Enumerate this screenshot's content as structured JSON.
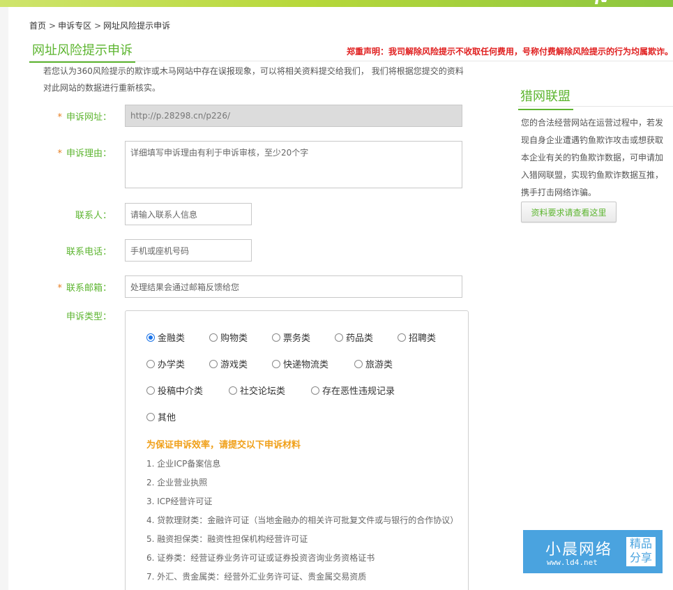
{
  "breadcrumb": {
    "home": "首页",
    "sep1": ">",
    "zone": "申诉专区",
    "sep2": ">",
    "current": "网址风险提示申诉"
  },
  "header": {
    "title": "网址风险提示申诉",
    "warning": "郑重声明：我司解除风险提示不收取任何费用，号称付费解除风险提示的行为均属欺诈。"
  },
  "intro": {
    "line1": "若您认为360风险提示的欺诈或木马网站中存在误报现象，可以将相关资料提交给我们， 我们将根据您提交的资料",
    "line2": "对此网站的数据进行重新核实。"
  },
  "form": {
    "required_mark": "*",
    "url_label": "申诉网址：",
    "url_value": "http://p.28298.cn/p226/",
    "reason_label": "申诉理由：",
    "reason_placeholder": "详细填写申诉理由有利于申诉审核，至少20个字",
    "contact_label": "联系人：",
    "contact_placeholder": "请输入联系人信息",
    "phone_label": "联系电话：",
    "phone_placeholder": "手机或座机号码",
    "email_label": "联系邮箱：",
    "email_placeholder": "处理结果会通过邮箱反馈给您",
    "type_label": "申诉类型："
  },
  "types": [
    {
      "label": "金融类",
      "checked": true
    },
    {
      "label": "购物类",
      "checked": false
    },
    {
      "label": "票务类",
      "checked": false
    },
    {
      "label": "药品类",
      "checked": false
    },
    {
      "label": "招聘类",
      "checked": false
    },
    {
      "label": "办学类",
      "checked": false
    },
    {
      "label": "游戏类",
      "checked": false
    },
    {
      "label": "快递物流类",
      "checked": false
    },
    {
      "label": "旅游类",
      "checked": false
    },
    {
      "label": "投稿中介类",
      "checked": false
    },
    {
      "label": "社交论坛类",
      "checked": false
    },
    {
      "label": "存在恶性违规记录",
      "checked": false
    },
    {
      "label": "其他",
      "checked": false
    }
  ],
  "materials": {
    "title": "为保证申诉效率，请提交以下申诉材料",
    "items": [
      "1. 企业ICP备案信息",
      "2. 企业营业执照",
      "3. ICP经营许可证",
      "4. 贷款理财类：金融许可证（当地金融办的相关许可批复文件或与银行的合作协议）",
      "5. 融资担保类：融资性担保机构经营许可证",
      "6. 证券类：经营证券业务许可证或证券投资咨询业务资格证书",
      "7. 外汇、贵金属类：经营外汇业务许可证、贵金属交易资质"
    ]
  },
  "sidebar": {
    "title": "猎网联盟",
    "lines": [
      "您的合法经营网站在运营过程中，若发",
      "现自身企业遭遇钓鱼欺诈攻击或想获取",
      "本企业有关的钓鱼欺诈数据，可申请加",
      "入猎网联盟，实现钓鱼欺诈数据互推，",
      "携手打击网络诈骗。"
    ],
    "button": "资料要求请查看这里"
  },
  "watermark": {
    "name": "小晨网络",
    "url": "www.ld4.net",
    "badge1": "精品",
    "badge2": "分享"
  },
  "colors": {
    "accent_green": "#5db530",
    "warning_red": "#e02020",
    "materials_orange": "#f0a01a",
    "radio_blue": "#1a73e8",
    "watermark_blue": "#4aa3df"
  }
}
